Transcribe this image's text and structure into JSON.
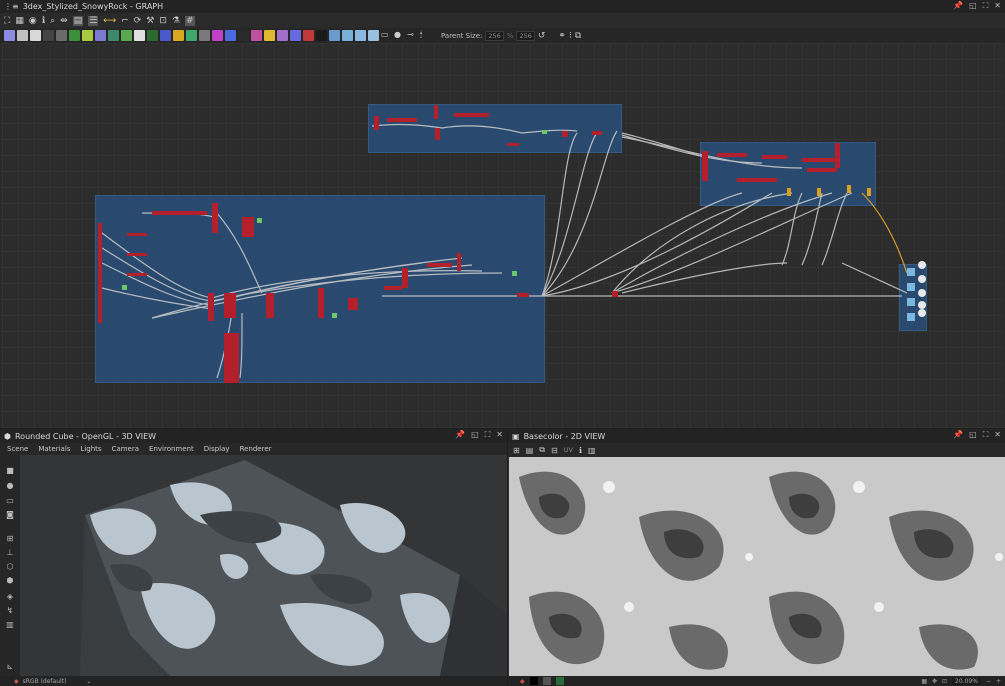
{
  "graph": {
    "title": "3dex_Stylized_SnowyRock - GRAPH",
    "toolbar": {
      "parent_size_label": "Parent Size:",
      "width": "256",
      "height": "256"
    }
  },
  "view3d": {
    "title": "Rounded Cube - OpenGL - 3D VIEW",
    "menu": [
      "Scene",
      "Materials",
      "Lights",
      "Camera",
      "Environment",
      "Display",
      "Renderer"
    ],
    "colorspace": "sRGB (default)"
  },
  "view2d": {
    "title": "Basecolor - 2D VIEW",
    "channel": "UV",
    "zoom": "20.09%"
  },
  "colors": {
    "frame": "#294a6e",
    "node": "#b3202b",
    "wire": "#cfcfcf",
    "accent": "#d99a2b"
  }
}
